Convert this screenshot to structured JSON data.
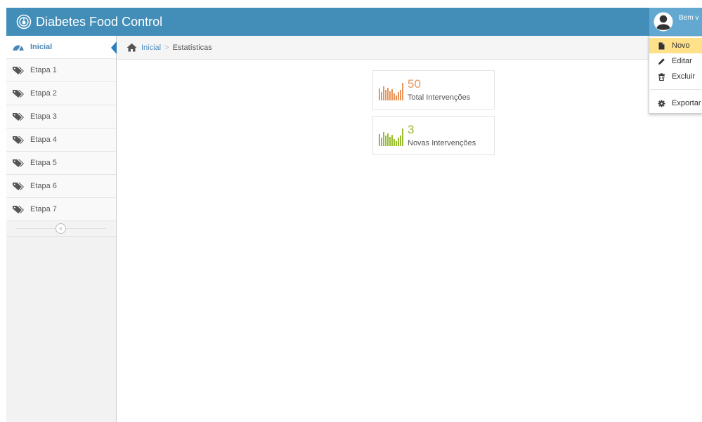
{
  "app": {
    "title": "Diabetes Food Control"
  },
  "user": {
    "welcome": "Bem v"
  },
  "sidebar": {
    "items": [
      {
        "label": "Inicial",
        "icon": "dashboard-icon",
        "active": true
      },
      {
        "label": "Etapa 1",
        "icon": "tags-icon"
      },
      {
        "label": "Etapa 2",
        "icon": "tags-icon"
      },
      {
        "label": "Etapa 3",
        "icon": "tags-icon"
      },
      {
        "label": "Etapa 4",
        "icon": "tags-icon"
      },
      {
        "label": "Etapa 5",
        "icon": "tags-icon"
      },
      {
        "label": "Etapa 6",
        "icon": "tags-icon"
      },
      {
        "label": "Etapa 7",
        "icon": "tags-icon"
      }
    ],
    "collapse_symbol": "«"
  },
  "breadcrumb": {
    "home": "Inicial",
    "separator": ">",
    "current": "Estatísticas"
  },
  "stats": [
    {
      "value": "50",
      "label": "Total Intervenções",
      "color": "#e8955d"
    },
    {
      "value": "3",
      "label": "Novas Intervenções",
      "color": "#9abc32"
    }
  ],
  "dropdown": {
    "items": [
      {
        "label": "Novo",
        "icon": "file-icon",
        "highlighted": true
      },
      {
        "label": "Editar",
        "icon": "pencil-icon"
      },
      {
        "label": "Excluir",
        "icon": "trash-icon"
      },
      {
        "label": "Exportar",
        "icon": "gear-icon"
      }
    ]
  },
  "colors": {
    "navbar": "#438eb9",
    "user_area": "#62a8d1",
    "active_link": "#4b88b7",
    "highlight": "#fee188"
  }
}
